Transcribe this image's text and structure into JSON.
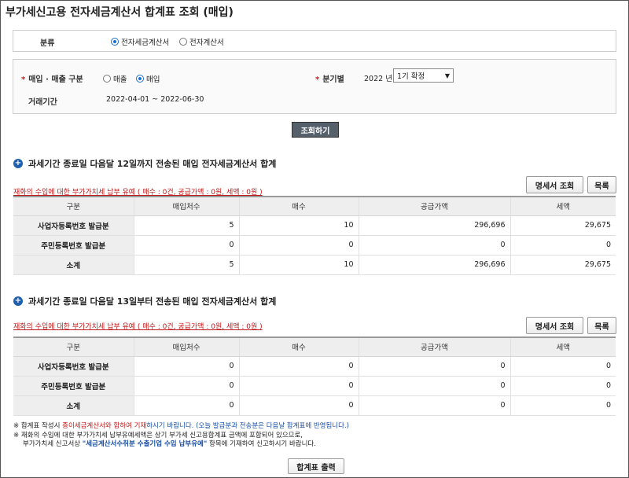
{
  "page": {
    "title": "부가세신고용 전자세금계산서 합계표 조회 (매입)"
  },
  "filter": {
    "category_label": "분류",
    "category_options": [
      "전자세금계산서",
      "전자계산서"
    ],
    "trade_label": "매입 · 매출 구분",
    "trade_options": [
      "매출",
      "매입"
    ],
    "quarter_label": "분기별",
    "quarter_year": "2022",
    "quarter_year_unit": "년",
    "quarter_select": "1기 확정",
    "period_label": "거래기간",
    "period_value": "2022-04-01 ~ 2022-06-30",
    "search_button": "조회하기"
  },
  "section1": {
    "title": "과세기간 종료일 다음달 12일까지 전송된 매입 전자세금계산서 합계",
    "notice": "재화의 수입에 대한 부가가치세 납부 유예 ( 매수 : 0건, 공급가액 : 0원, 세액 : 0원 )",
    "detail_button": "명세서 조회",
    "list_button": "목록",
    "headers": [
      "구분",
      "매입처수",
      "매수",
      "공급가액",
      "세액"
    ],
    "rows": [
      [
        "사업자등록번호 발급분",
        "5",
        "10",
        "296,696",
        "29,675"
      ],
      [
        "주민등록번호 발급분",
        "0",
        "0",
        "0",
        "0"
      ],
      [
        "소계",
        "5",
        "10",
        "296,696",
        "29,675"
      ]
    ]
  },
  "section2": {
    "title": "과세기간 종료일 다음달 13일부터 전송된 매입 전자세금계산서 합계",
    "notice": "재화의 수입에 대한 부가가치세 납부 유예 ( 매수 : 0건, 공급가액 : 0원, 세액 : 0원 )",
    "detail_button": "명세서 조회",
    "list_button": "목록",
    "headers": [
      "구분",
      "매입처수",
      "매수",
      "공급가액",
      "세액"
    ],
    "rows": [
      [
        "사업자등록번호 발급분",
        "0",
        "0",
        "0",
        "0"
      ],
      [
        "주민등록번호 발급분",
        "0",
        "0",
        "0",
        "0"
      ],
      [
        "소계",
        "0",
        "0",
        "0",
        "0"
      ]
    ]
  },
  "notes": {
    "n1_a": "※ 합계표 작성시 ",
    "n1_b": "종이세금계산서와 합하여 기재",
    "n1_c": "하시기 바랍니다. (오늘 발급분과 전송분은 다음날 합계표에 반영됩니다.)",
    "n2": "※ 재화의 수입에 대한 부가가치세 납부유예세액은 상기 부가세 신고용합계표 금액에 포함되어 있으므로,",
    "n3_a": "부가가치세 신고서상 ",
    "n3_b": "\"세금계산서수취분 수출기업 수입 납부유예\"",
    "n3_c": " 항목에 기재하여 신고하시기 바랍니다."
  },
  "print_button": "합계표 출력"
}
